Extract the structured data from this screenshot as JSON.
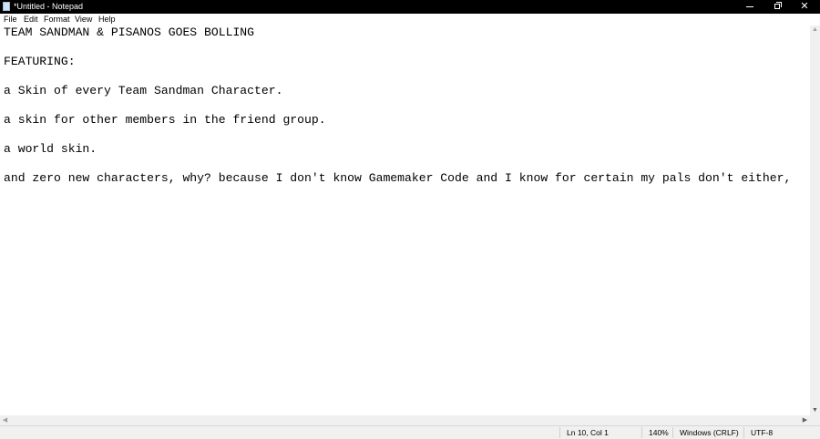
{
  "window": {
    "title": "*Untitled - Notepad",
    "minimize_glyph": "",
    "close_glyph": "✕"
  },
  "menu": {
    "file": "File",
    "edit": "Edit",
    "format": "Format",
    "view": "View",
    "help": "Help"
  },
  "document": {
    "lines": [
      "TEAM SANDMAN & PISANOS GOES BOLLING",
      "",
      "FEATURING:",
      "",
      "a Skin of every Team Sandman Character.",
      "",
      "a skin for other members in the friend group.",
      "",
      "a world skin.",
      "",
      "and zero new characters, why? because I don't know Gamemaker Code and I know for certain my pals don't either,"
    ]
  },
  "scrollbars": {
    "up": "▲",
    "down": "▼",
    "left": "◀",
    "right": "▶"
  },
  "status": {
    "position": "Ln 10, Col 1",
    "zoom": "140%",
    "line_ending": "Windows (CRLF)",
    "encoding": "UTF-8"
  }
}
